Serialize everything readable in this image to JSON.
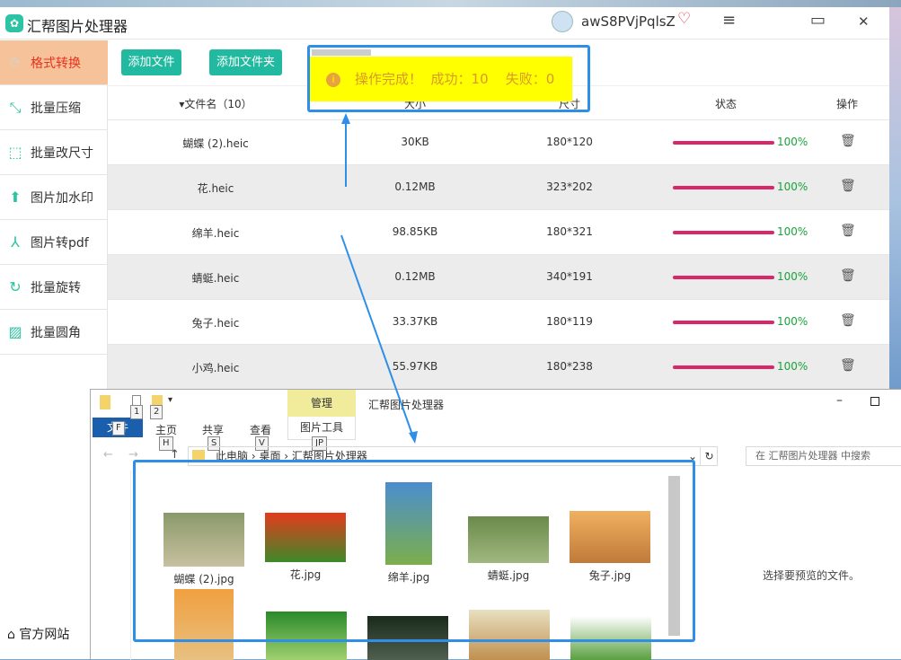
{
  "app": {
    "title": "汇帮图片处理器",
    "user": "awS8PVjPqlsZ",
    "controls": {
      "menu": "≡",
      "maximize": "▭",
      "close": "✕"
    }
  },
  "sidebar": {
    "items": [
      {
        "label": "格式转换",
        "icon": "refresh-icon",
        "glyph": "⟳"
      },
      {
        "label": "批量压缩",
        "icon": "compress-icon",
        "glyph": "⤡"
      },
      {
        "label": "批量改尺寸",
        "icon": "resize-icon",
        "glyph": "⬚"
      },
      {
        "label": "图片加水印",
        "icon": "watermark-icon",
        "glyph": "⬆"
      },
      {
        "label": "图片转pdf",
        "icon": "pdf-icon",
        "glyph": "⅄"
      },
      {
        "label": "批量旋转",
        "icon": "rotate-icon",
        "glyph": "↻"
      },
      {
        "label": "批量圆角",
        "icon": "image-icon",
        "glyph": "▨"
      }
    ],
    "footer": "官方网站"
  },
  "toolbar": {
    "add_file": "添加文件",
    "add_folder": "添加文件夹"
  },
  "table": {
    "headers": {
      "name": "▾文件名（10）",
      "size": "大小",
      "dims": "尺寸",
      "status": "状态",
      "action": "操作"
    },
    "rows": [
      {
        "name": "蝴蝶 (2).heic",
        "size": "30KB",
        "dims": "180*120",
        "progress": "100%"
      },
      {
        "name": "花.heic",
        "size": "0.12MB",
        "dims": "323*202",
        "progress": "100%"
      },
      {
        "name": "绵羊.heic",
        "size": "98.85KB",
        "dims": "180*321",
        "progress": "100%"
      },
      {
        "name": "蜻蜓.heic",
        "size": "0.12MB",
        "dims": "340*191",
        "progress": "100%"
      },
      {
        "name": "兔子.heic",
        "size": "33.37KB",
        "dims": "180*119",
        "progress": "100%"
      },
      {
        "name": "小鸡.heic",
        "size": "55.97KB",
        "dims": "180*238",
        "progress": "100%"
      }
    ]
  },
  "toast": {
    "text": "操作完成！  成功：10    失败：0"
  },
  "explorer": {
    "title": "汇帮图片处理器",
    "manage": "管理",
    "tabs": {
      "file": "文件",
      "home": "主页",
      "share": "共享",
      "view": "查看",
      "picture_tools": "图片工具"
    },
    "keys": [
      "1",
      "2",
      "F",
      "H",
      "S",
      "V",
      "JP"
    ],
    "path": [
      "此电脑",
      "桌面",
      "汇帮图片处理器"
    ],
    "search_placeholder": "在 汇帮图片处理器 中搜索",
    "preview": "选择要预览的文件。",
    "files": [
      "蝴蝶 (2).jpg",
      "花.jpg",
      "绵羊.jpg",
      "蜻蜓.jpg",
      "兔子.jpg"
    ],
    "colors": {
      "accent": "#2f8fe8",
      "teal": "#21b9a0",
      "progress": "#d9276a"
    }
  }
}
